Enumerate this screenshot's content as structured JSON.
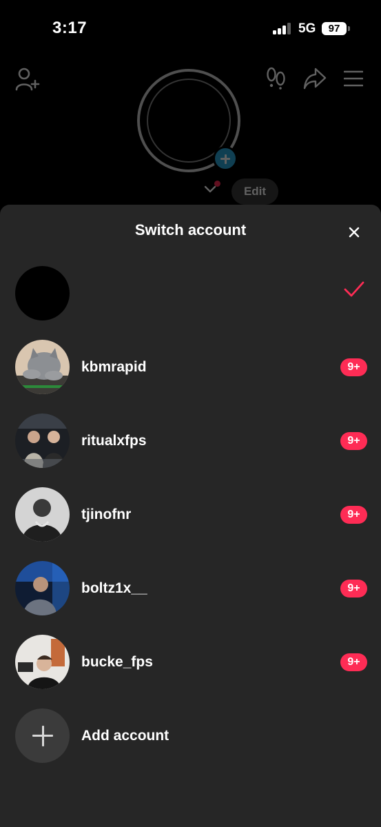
{
  "status_bar": {
    "time": "3:17",
    "network": "5G",
    "battery": "97"
  },
  "profile": {
    "edit_label": "Edit"
  },
  "sheet": {
    "title": "Switch account",
    "accounts": [
      {
        "name": "",
        "selected": true
      },
      {
        "name": "kbmrapid",
        "badge": "9+"
      },
      {
        "name": "ritualxfps",
        "badge": "9+"
      },
      {
        "name": "tjinofnr",
        "badge": "9+"
      },
      {
        "name": "boltz1x__",
        "badge": "9+"
      },
      {
        "name": "bucke_fps",
        "badge": "9+"
      }
    ],
    "add_account_label": "Add account"
  },
  "icons": {
    "add_user": "add-user-icon",
    "footprints": "footprints-icon",
    "share": "share-icon",
    "menu": "menu-icon",
    "close": "close-icon",
    "check": "check-icon",
    "plus": "plus-icon"
  },
  "colors": {
    "accent": "#fe2c55",
    "sheet_bg": "#262626",
    "add_photo": "#2aa6d8"
  }
}
